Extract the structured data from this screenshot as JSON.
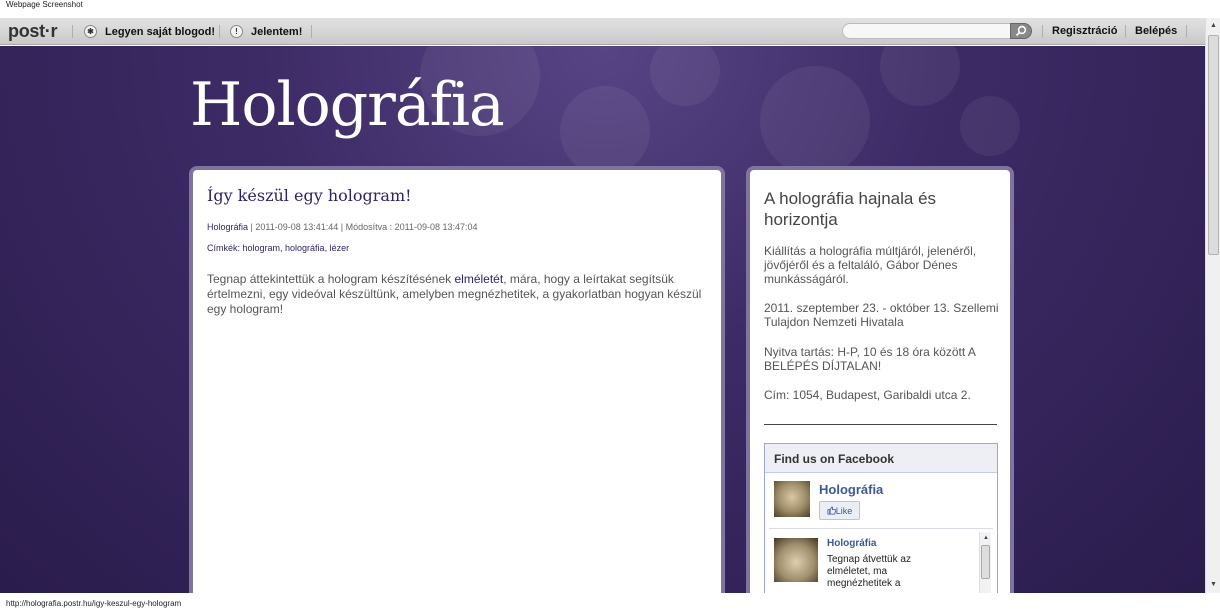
{
  "window": {
    "title": "Webpage Screenshot"
  },
  "topbar": {
    "logo": "post·r",
    "blog_link": "Legyen saját blogod!",
    "blog_icon": "✱",
    "report_link": "Jelentem!",
    "report_icon": "!",
    "search_placeholder": "",
    "register_link": "Regisztráció",
    "login_link": "Belépés"
  },
  "site": {
    "title": "Holográfia"
  },
  "post": {
    "title": "Így készül egy hologram!",
    "category": "Holográfia",
    "meta": " | 2011-09-08 13:41:44 | Módosítva : 2011-09-08 13:47:04",
    "tags_label": "Címkék: ",
    "tags": "hologram, holográfia, lézer",
    "body_before": "Tegnap áttekintettük a hologram készítésének ",
    "body_link": "elméletét",
    "body_after": ", mára, hogy a leírtakat segítsük értelmezni, egy videóval készültünk, amelyben megnézhetitek, a gyakorlatban hogyan készül egy hologram!"
  },
  "sidebar": {
    "title": "A holográfia hajnala és horizontja",
    "para1": "Kiállítás a holográfia múltjáról, jelenéről, jövőjéről és a feltaláló, Gábor Dénes munkásságáról.",
    "para2": "2011. szeptember 23. - október 13. Szellemi Tulajdon Nemzeti Hivatala",
    "para3": "Nyitva tartás: H-P, 10 és 18 óra között A BELÉPÉS DÍJTALAN!",
    "para4": "Cím: 1054, Budapest, Garibaldi utca 2."
  },
  "facebook": {
    "header": "Find us on Facebook",
    "page_name": "Holográfia",
    "like_label": "Like",
    "post_author": "Holográfia",
    "post_text": "Tegnap átvettük az elméletet, ma megnézhetitek a"
  },
  "status": {
    "url": "http://holografia.postr.hu/igy-keszul-egy-hologram"
  },
  "colors": {
    "background": "#3d2b66",
    "panel_border": "#7f749d",
    "accent": "#2c2466",
    "facebook": "#3b5998"
  }
}
